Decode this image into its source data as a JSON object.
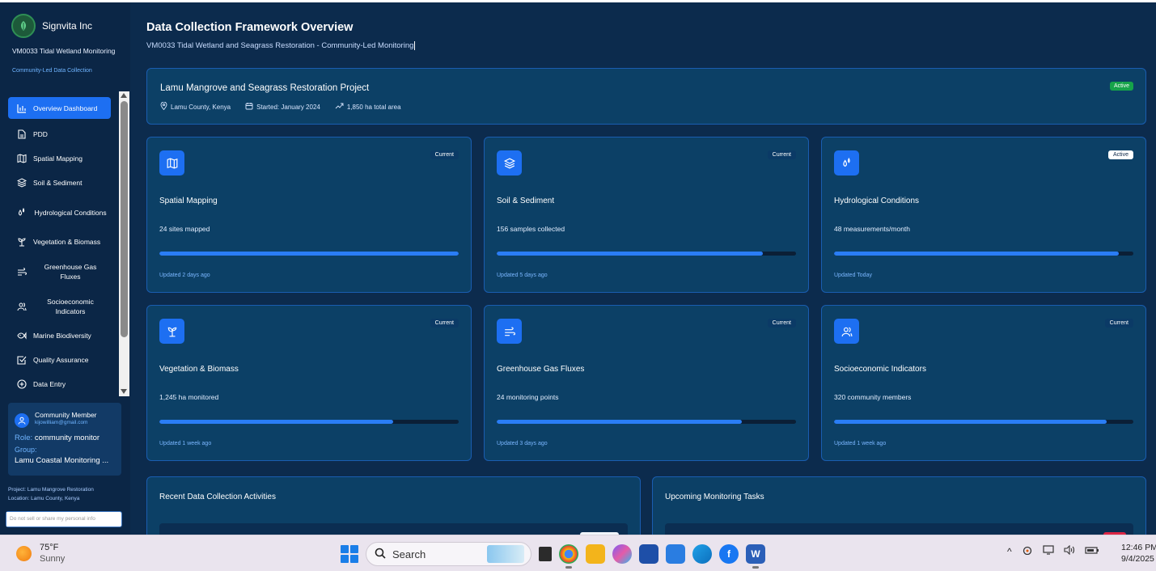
{
  "sidebar": {
    "brand": "Signvita Inc",
    "subtitle": "VM0033 Tidal Wetland Monitoring",
    "subtitle2": "Community-Led Data Collection",
    "nav": [
      {
        "label": "Overview Dashboard",
        "icon": "bar-chart-icon",
        "active": true
      },
      {
        "label": "PDD",
        "icon": "file-icon"
      },
      {
        "label": "Spatial Mapping",
        "icon": "map-icon"
      },
      {
        "label": "Soil & Sediment",
        "icon": "layers-icon"
      },
      {
        "label": "Hydrological Conditions",
        "icon": "droplets-icon"
      },
      {
        "label": "Vegetation & Biomass",
        "icon": "sprout-icon"
      },
      {
        "label": "Greenhouse Gas Fluxes",
        "icon": "wind-icon"
      },
      {
        "label": "Socioeconomic Indicators",
        "icon": "users-icon"
      },
      {
        "label": "Marine Biodiversity",
        "icon": "fish-icon"
      },
      {
        "label": "Quality Assurance",
        "icon": "check-square-icon"
      },
      {
        "label": "Data Entry",
        "icon": "plus-circle-icon"
      }
    ],
    "user": {
      "name": "Community Member",
      "email": "kijowilliam@gmail.com",
      "role_key": "Role:",
      "role": "community monitor",
      "group_key": "Group:",
      "group": "Lamu Coastal Monitoring ..."
    },
    "project_line": "Project: Lamu Mangrove Restoration",
    "location_line": "Location: Lamu County, Kenya",
    "privacy": "Do not sell or share my personal info"
  },
  "header": {
    "title": "Data Collection Framework Overview",
    "subtitle": "VM0033 Tidal Wetland and Seagrass Restoration - Community-Led Monitoring"
  },
  "project": {
    "title": "Lamu Mangrove and Seagrass Restoration Project",
    "location": "Lamu County, Kenya",
    "started": "Started: January 2024",
    "area": "1,850 ha total area",
    "status": "Active",
    "status_color": "#16a34a"
  },
  "cards": [
    {
      "title": "Spatial Mapping",
      "value": "24 sites mapped",
      "updated": "Updated 2 days ago",
      "badge": "Current",
      "progress": 1.0,
      "icon": "map-icon"
    },
    {
      "title": "Soil & Sediment",
      "value": "156 samples collected",
      "updated": "Updated 5 days ago",
      "badge": "Current",
      "progress": 0.89,
      "icon": "layers-icon"
    },
    {
      "title": "Hydrological Conditions",
      "value": "48 measurements/month",
      "updated": "Updated Today",
      "badge": "Active",
      "progress": 0.95,
      "icon": "droplets-icon"
    },
    {
      "title": "Vegetation & Biomass",
      "value": "1,245 ha monitored",
      "updated": "Updated 1 week ago",
      "badge": "Current",
      "progress": 0.78,
      "icon": "sprout-icon"
    },
    {
      "title": "Greenhouse Gas Fluxes",
      "value": "24 monitoring points",
      "updated": "Updated 3 days ago",
      "badge": "Current",
      "progress": 0.82,
      "icon": "wind-icon"
    },
    {
      "title": "Socioeconomic Indicators",
      "value": "320 community members",
      "updated": "Updated 1 week ago",
      "badge": "Current",
      "progress": 0.91,
      "icon": "users-icon"
    }
  ],
  "panels": {
    "recent": "Recent Data Collection Activities",
    "upcoming": "Upcoming Monitoring Tasks"
  },
  "taskbar": {
    "temp": "75°F",
    "condition": "Sunny",
    "search": "Search",
    "time": "12:46 PM",
    "date": "9/4/2025"
  },
  "colors": {
    "accent": "#1d6ff2",
    "background": "#0c2b4d",
    "card": "#0c4066"
  }
}
